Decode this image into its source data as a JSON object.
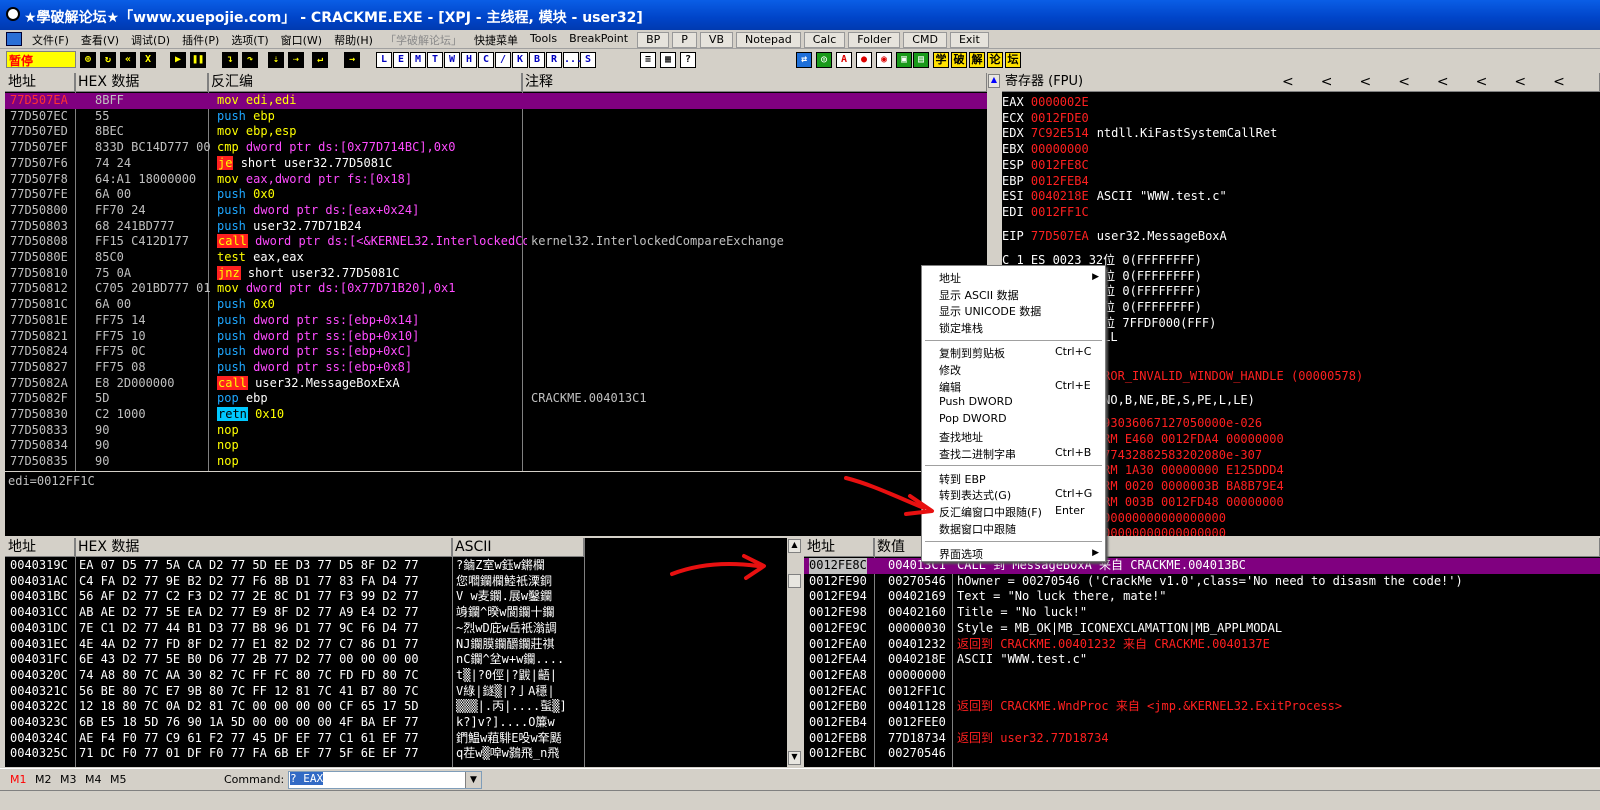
{
  "window": {
    "title": "★學破解论坛★「www.xuepojie.com」 - CRACKME.EXE - [XPJ - 主线程, 模块 - user32]"
  },
  "menu": [
    {
      "label": "文件(F)"
    },
    {
      "label": "查看(V)"
    },
    {
      "label": "调试(D)"
    },
    {
      "label": "插件(P)"
    },
    {
      "label": "选项(T)"
    },
    {
      "label": "窗口(W)"
    },
    {
      "label": "帮助(H)"
    },
    {
      "label": "「学破解论坛」",
      "disabled": true
    },
    {
      "label": "快捷菜单"
    },
    {
      "label": "Tools"
    },
    {
      "label": "BreakPoint"
    }
  ],
  "menu_buttons": [
    "BP",
    "P",
    "VB",
    "Notepad",
    "Calc",
    "Folder",
    "CMD",
    "Exit"
  ],
  "toolbar": {
    "status": "暂停",
    "letters": [
      "L",
      "E",
      "M",
      "T",
      "W",
      "H",
      "C",
      "/",
      "K",
      "B",
      "R",
      "...",
      "S"
    ],
    "chinese": [
      "学",
      "破",
      "解",
      "论",
      "坛"
    ]
  },
  "cpu": {
    "headers": {
      "addr": "地址",
      "hex": "HEX 数据",
      "dis": "反汇编",
      "cmt": "注释"
    },
    "rows": [
      {
        "addr": "77D507EA",
        "hex": "8BFF",
        "mn": "mov",
        "ops": "edi,edi",
        "cmt": "",
        "sel": true
      },
      {
        "addr": "77D507EC",
        "hex": "55",
        "mn": "push",
        "ops": "ebp",
        "cmt": ""
      },
      {
        "addr": "77D507ED",
        "hex": "8BEC",
        "mn": "mov",
        "ops": "ebp,esp",
        "cmt": ""
      },
      {
        "addr": "77D507EF",
        "hex": "833D BC14D777 00",
        "mn": "cmp",
        "ops": "dword ptr ds:[0x77D714BC],0x0",
        "cmt": ""
      },
      {
        "addr": "77D507F6",
        "hex": "74 24",
        "mn": "je",
        "ops": "short user32.77D5081C",
        "cmt": ""
      },
      {
        "addr": "77D507F8",
        "hex": "64:A1 18000000",
        "mn": "mov",
        "ops": "eax,dword ptr fs:[0x18]",
        "cmt": ""
      },
      {
        "addr": "77D507FE",
        "hex": "6A 00",
        "mn": "push",
        "ops": "0x0",
        "cmt": ""
      },
      {
        "addr": "77D50800",
        "hex": "FF70 24",
        "mn": "push",
        "ops": "dword ptr ds:[eax+0x24]",
        "cmt": ""
      },
      {
        "addr": "77D50803",
        "hex": "68 241BD777",
        "mn": "push",
        "ops": "user32.77D71B24",
        "cmt": ""
      },
      {
        "addr": "77D50808",
        "hex": "FF15 C412D177",
        "mn": "call",
        "ops": "dword ptr ds:[<&KERNEL32.InterlockedCompareExchange>]",
        "cmt": "kernel32.InterlockedCompareExchange"
      },
      {
        "addr": "77D5080E",
        "hex": "85C0",
        "mn": "test",
        "ops": "eax,eax",
        "cmt": ""
      },
      {
        "addr": "77D50810",
        "hex": "75 0A",
        "mn": "jnz",
        "ops": "short user32.77D5081C",
        "cmt": ""
      },
      {
        "addr": "77D50812",
        "hex": "C705 201BD777 01",
        "mn": "mov",
        "ops": "dword ptr ds:[0x77D71B20],0x1",
        "cmt": ""
      },
      {
        "addr": "77D5081C",
        "hex": "6A 00",
        "mn": "push",
        "ops": "0x0",
        "cmt": ""
      },
      {
        "addr": "77D5081E",
        "hex": "FF75 14",
        "mn": "push",
        "ops": "dword ptr ss:[ebp+0x14]",
        "cmt": ""
      },
      {
        "addr": "77D50821",
        "hex": "FF75 10",
        "mn": "push",
        "ops": "dword ptr ss:[ebp+0x10]",
        "cmt": ""
      },
      {
        "addr": "77D50824",
        "hex": "FF75 0C",
        "mn": "push",
        "ops": "dword ptr ss:[ebp+0xC]",
        "cmt": ""
      },
      {
        "addr": "77D50827",
        "hex": "FF75 08",
        "mn": "push",
        "ops": "dword ptr ss:[ebp+0x8]",
        "cmt": ""
      },
      {
        "addr": "77D5082A",
        "hex": "E8 2D000000",
        "mn": "call",
        "ops": "user32.MessageBoxExA",
        "cmt": ""
      },
      {
        "addr": "77D5082F",
        "hex": "5D",
        "mn": "pop",
        "ops": "ebp",
        "cmt": "CRACKME.004013C1"
      },
      {
        "addr": "77D50830",
        "hex": "C2 1000",
        "mn": "retn",
        "ops": "0x10",
        "cmt": ""
      },
      {
        "addr": "77D50833",
        "hex": "90",
        "mn": "nop",
        "ops": "",
        "cmt": ""
      },
      {
        "addr": "77D50834",
        "hex": "90",
        "mn": "nop",
        "ops": "",
        "cmt": ""
      },
      {
        "addr": "77D50835",
        "hex": "90",
        "mn": "nop",
        "ops": "",
        "cmt": ""
      }
    ],
    "info": "edi=0012FF1C"
  },
  "registers": {
    "header": "寄存器 (FPU)",
    "lines": [
      {
        "n": "EAX",
        "v": "0000002E",
        "c": ""
      },
      {
        "n": "ECX",
        "v": "0012FDE0",
        "c": ""
      },
      {
        "n": "EDX",
        "v": "7C92E514",
        "c": "ntdll.KiFastSystemCallRet"
      },
      {
        "n": "EBX",
        "v": "00000000",
        "c": ""
      },
      {
        "n": "ESP",
        "v": "0012FE8C",
        "c": ""
      },
      {
        "n": "EBP",
        "v": "0012FEB4",
        "c": ""
      },
      {
        "n": "ESI",
        "v": "0040218E",
        "c": "ASCII \"WWW.test.c\""
      },
      {
        "n": "EDI",
        "v": "0012FF1C",
        "c": ""
      },
      {
        "n": "EIP",
        "v": "77D507EA",
        "c": "user32.MessageBoxA"
      }
    ],
    "seg_lines": [
      "C 1  ES 0023 32位 0(FFFFFFFF)",
      "P 0  CS 001B 32位 0(FFFFFFFF)",
      "A 0  SS 0023 32位 0(FFFFFFFF)",
      "Z 0  DS 0023 32位 0(FFFFFFFF)",
      "S 0  FS 003B 32位 7FFDF000(FFF)",
      "T 0  GS 0000 NULL",
      "D 0",
      "O 0  LastErr ERROR_INVALID_WINDOW_HANDLE (00000578)",
      "EFL 00000293 (NO,B,NE,BE,S,PE,L,LE)",
      "ST0 empty 3.9093036067127050000e-026",
      "ST1 empty -UNORM E460 0012FDA4 00000000",
      "ST2 empty 6.4277432882583202080e-307",
      "ST3 empty -UNORM 1A30 00000000 E125DDD4",
      "ST4 empty -UNORM 0020 0000003B BA8B79E4",
      "ST5 empty -UNORM 003B 0012FD48 00000000",
      "ST6 empty 0.0000000000000000000",
      "ST7 empty 0.0000000000000000000"
    ]
  },
  "context_menu": {
    "items": [
      {
        "label": "地址",
        "shortcut": "",
        "sub": true
      },
      {
        "label": "显示 ASCII 数据",
        "shortcut": ""
      },
      {
        "label": "显示 UNICODE 数据",
        "shortcut": ""
      },
      {
        "label": "锁定堆栈",
        "shortcut": ""
      },
      {
        "label": "复制到剪贴板",
        "shortcut": "Ctrl+C"
      },
      {
        "label": "修改",
        "shortcut": ""
      },
      {
        "label": "编辑",
        "shortcut": "Ctrl+E"
      },
      {
        "label": "Push DWORD",
        "shortcut": ""
      },
      {
        "label": "Pop DWORD",
        "shortcut": ""
      },
      {
        "label": "查找地址",
        "shortcut": ""
      },
      {
        "label": "查找二进制字串",
        "shortcut": "Ctrl+B"
      },
      {
        "label": "转到 EBP",
        "shortcut": ""
      },
      {
        "label": "转到表达式(G)",
        "shortcut": "Ctrl+G"
      },
      {
        "label": "反汇编窗口中跟随(F)",
        "shortcut": "Enter"
      },
      {
        "label": "数据窗口中跟随",
        "shortcut": ""
      },
      {
        "label": "界面选项",
        "shortcut": "",
        "sub": true
      }
    ]
  },
  "dump": {
    "headers": {
      "addr": "地址",
      "hex": "HEX 数据",
      "ascii": "ASCII"
    },
    "rows": [
      {
        "addr": "0040319C",
        "hex": "EA 07 D5 77|5A CA D2 77|5D EE D3 77|D5 8F D2 77",
        "ascii": "?鏀Z室w鈺w鏘欄"
      },
      {
        "addr": "004031AC",
        "hex": "C4 FA D2 77|9E B2 D2 77|F6 8B D1 77|83 FA D4 77",
        "ascii": "您嚪鑭欄鯥衹溧銅"
      },
      {
        "addr": "004031BC",
        "hex": "56 AF D2 77|C2 F3 D2 77|2E 8C D1 77|F3 99 D2 77",
        "ascii": "V  w麦鑭.展w鑿鑭"
      },
      {
        "addr": "004031CC",
        "hex": "AB AE D2 77|5E EA D2 77|E9 8F D2 77|A9 E4 D2 77",
        "ascii": "竧鑭^暌w閬鑭十鑭"
      },
      {
        "addr": "004031DC",
        "hex": "7E C1 D2 77|44 B1 D3 77|B8 96 D1 77|9C F6 D4 77",
        "ascii": "~烈wD庇w岳衹滃調"
      },
      {
        "addr": "004031EC",
        "hex": "4E 4A D2 77|FD 8F D2 77|E1 82 D2 77|C7 86 D1 77",
        "ascii": "NJ鑭膜鑭釂鑭莊祺"
      },
      {
        "addr": "004031FC",
        "hex": "6E 43 D2 77|5E B0 D6 77|2B 77 D2 77|00 00 00 00",
        "ascii": "nC鑭^坌w+w鑭...."
      },
      {
        "addr": "0040320C",
        "hex": "74 A8 80 7C|AA 30 82 7C|FF FC 80 7C|FD FD 80 7C",
        "ascii": "t▒|?0俓|?鼥|齬|"
      },
      {
        "addr": "0040321C",
        "hex": "56 BE 80 7C|E7 9B 80 7C|FF 12 81 7C|41 B7 80 7C",
        "ascii": "V綠|鐩▒|?亅A穩|"
      },
      {
        "addr": "0040322C",
        "hex": "12 18 80 7C|0A D2 81 7C|00 00 00 00|CF 65 17 5D",
        "ascii": "▒▒▒|.丙|....蟚▒]"
      },
      {
        "addr": "0040323C",
        "hex": "6B E5 18 5D|76 90 1A 5D|00 00 00 00|4F BA EF 77",
        "ascii": "k?]v?]....O簾w"
      },
      {
        "addr": "0040324C",
        "hex": "AE F4 F0 77|C9 61 F2 77|45 DF EF 77|C1 61 EF 77",
        "ascii": "鍆鰛w蒩騑E吺w羍颳"
      },
      {
        "addr": "0040325C",
        "hex": "71 DC F0 77|01 DF F0 77|FA 6B EF 77|5F 6E EF 77",
        "ascii": "q茬w▒唕w鷋飛_n飛"
      }
    ]
  },
  "stack": {
    "headers": {
      "addr": "地址",
      "val": "数值",
      "cmt": "注释"
    },
    "rows": [
      {
        "addr": "0012FE8C",
        "val": "004013C1",
        "cmt": "CALL 到 MessageBoxA 来自 CRACKME.004013BC",
        "sel": true,
        "style": "sel"
      },
      {
        "addr": "0012FE90",
        "val": "00270546",
        "cmt": "hOwner = 00270546 ('CrackMe v1.0',class='No need to disasm the code!')",
        "style": "w"
      },
      {
        "addr": "0012FE94",
        "val": "00402169",
        "cmt": "Text = \"No luck there, mate!\"",
        "style": "w"
      },
      {
        "addr": "0012FE98",
        "val": "00402160",
        "cmt": "Title = \"No luck!\"",
        "style": "w"
      },
      {
        "addr": "0012FE9C",
        "val": "00000030",
        "cmt": "Style = MB_OK|MB_ICONEXCLAMATION|MB_APPLMODAL",
        "style": "w"
      },
      {
        "addr": "0012FEA0",
        "val": "00401232",
        "cmt": "返回到 CRACKME.00401232 来自 CRACKME.0040137E",
        "style": "r"
      },
      {
        "addr": "0012FEA4",
        "val": "0040218E",
        "cmt": "ASCII \"WWW.test.c\"",
        "style": "w"
      },
      {
        "addr": "0012FEA8",
        "val": "00000000",
        "cmt": "",
        "style": "w"
      },
      {
        "addr": "0012FEAC",
        "val": "0012FF1C",
        "cmt": "",
        "style": "w"
      },
      {
        "addr": "0012FEB0",
        "val": "00401128",
        "cmt": "返回到 CRACKME.WndProc 来自 <jmp.&KERNEL32.ExitProcess>",
        "style": "r"
      },
      {
        "addr": "0012FEB4",
        "val": "0012FEE0",
        "cmt": "",
        "style": "w"
      },
      {
        "addr": "0012FEB8",
        "val": "77D18734",
        "cmt": "返回到 user32.77D18734",
        "style": "r"
      },
      {
        "addr": "0012FEBC",
        "val": "00270546",
        "cmt": "",
        "style": "w"
      }
    ]
  },
  "bottom": {
    "tabs": [
      "M1",
      "M2",
      "M3",
      "M4",
      "M5"
    ],
    "command_label": "Command:",
    "command_value": "? EAX"
  },
  "colors": {
    "selection": "#800080",
    "title_bar": "#0044c8",
    "red": "#ff2020",
    "push_blue": "#1ea7ff"
  }
}
